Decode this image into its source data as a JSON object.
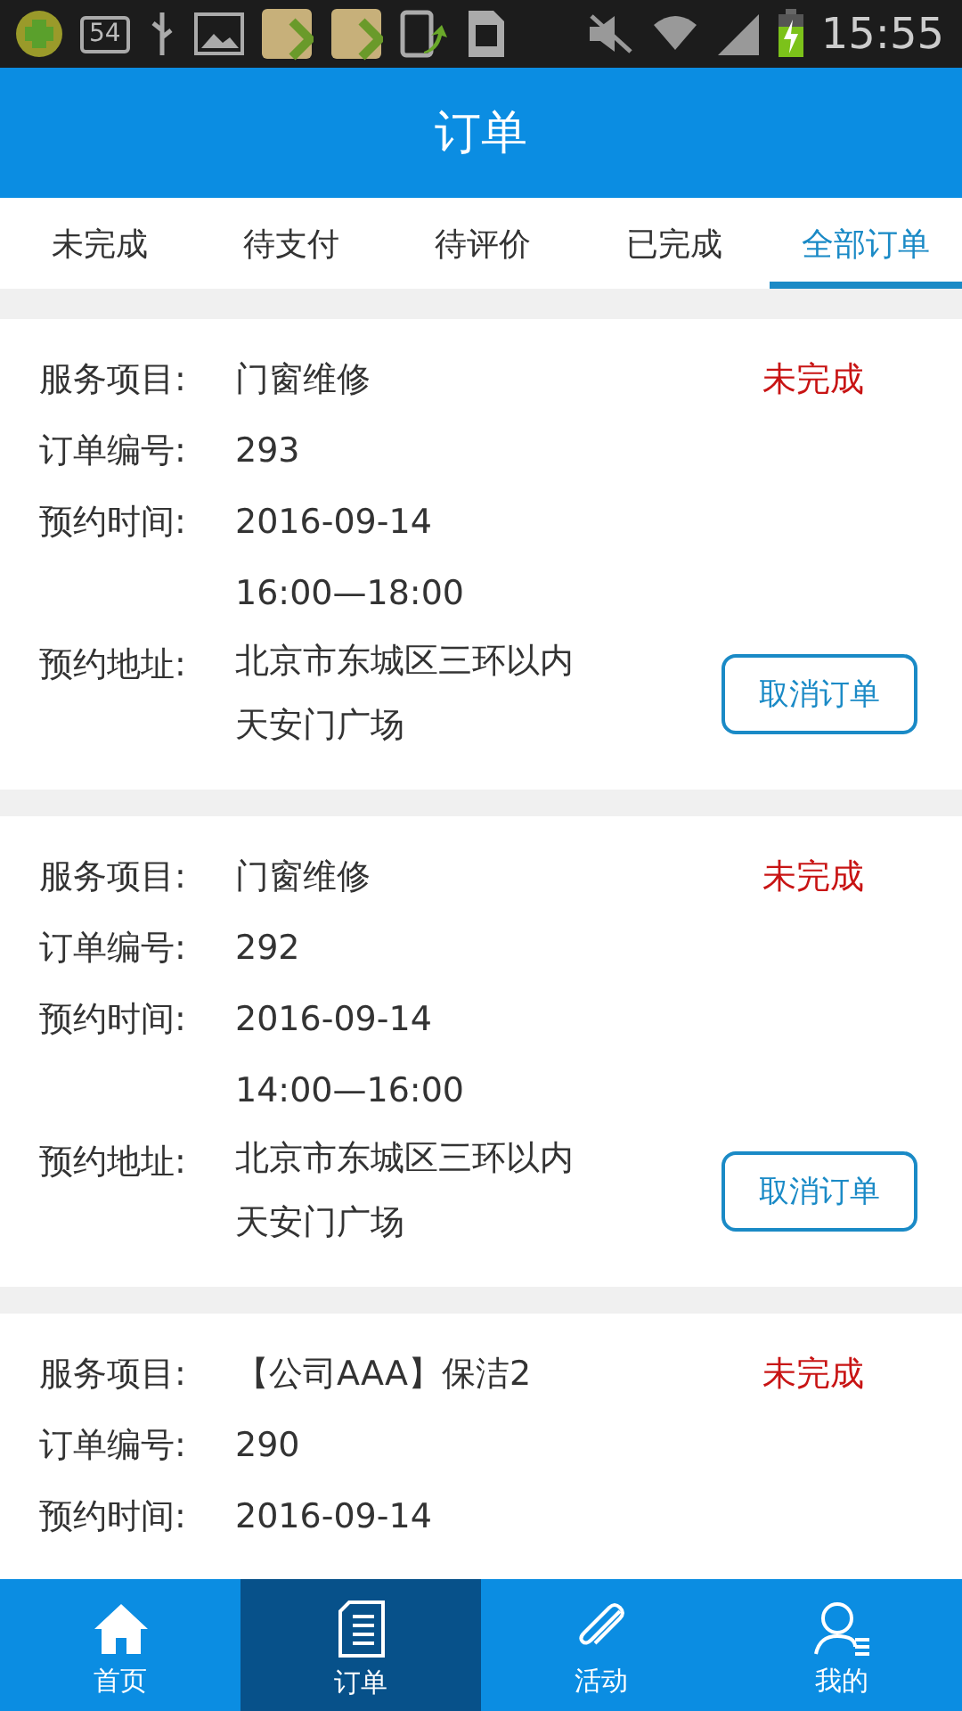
{
  "status_bar": {
    "badge": "54",
    "time": "15:55"
  },
  "header": {
    "title": "订单"
  },
  "tabs": [
    {
      "label": "未完成",
      "selected": false
    },
    {
      "label": "待支付",
      "selected": false
    },
    {
      "label": "待评价",
      "selected": false
    },
    {
      "label": "已完成",
      "selected": false
    },
    {
      "label": "全部订单",
      "selected": true
    }
  ],
  "orders": [
    {
      "status": "未完成",
      "action": "取消订单",
      "fields": [
        {
          "label": "服务项目:",
          "lines": [
            "门窗维修"
          ]
        },
        {
          "label": "订单编号:",
          "lines": [
            "293"
          ]
        },
        {
          "label": "预约时间:",
          "lines": [
            "2016-09-14",
            "16:00—18:00"
          ]
        },
        {
          "label": "预约地址:",
          "lines": [
            "北京市东城区三环以内",
            "天安门广场"
          ]
        }
      ]
    },
    {
      "status": "未完成",
      "action": "取消订单",
      "fields": [
        {
          "label": "服务项目:",
          "lines": [
            "门窗维修"
          ]
        },
        {
          "label": "订单编号:",
          "lines": [
            "292"
          ]
        },
        {
          "label": "预约时间:",
          "lines": [
            "2016-09-14",
            "14:00—16:00"
          ]
        },
        {
          "label": "预约地址:",
          "lines": [
            "北京市东城区三环以内",
            "天安门广场"
          ]
        }
      ]
    },
    {
      "status": "未完成",
      "fields": [
        {
          "label": "服务项目:",
          "lines": [
            "【公司AAA】保洁2"
          ]
        },
        {
          "label": "订单编号:",
          "lines": [
            "290"
          ]
        },
        {
          "label": "预约时间:",
          "lines": [
            "2016-09-14"
          ]
        }
      ]
    }
  ],
  "bottom_nav": [
    {
      "label": "首页",
      "selected": false
    },
    {
      "label": "订单",
      "selected": true
    },
    {
      "label": "活动",
      "selected": false
    },
    {
      "label": "我的",
      "selected": false
    }
  ]
}
